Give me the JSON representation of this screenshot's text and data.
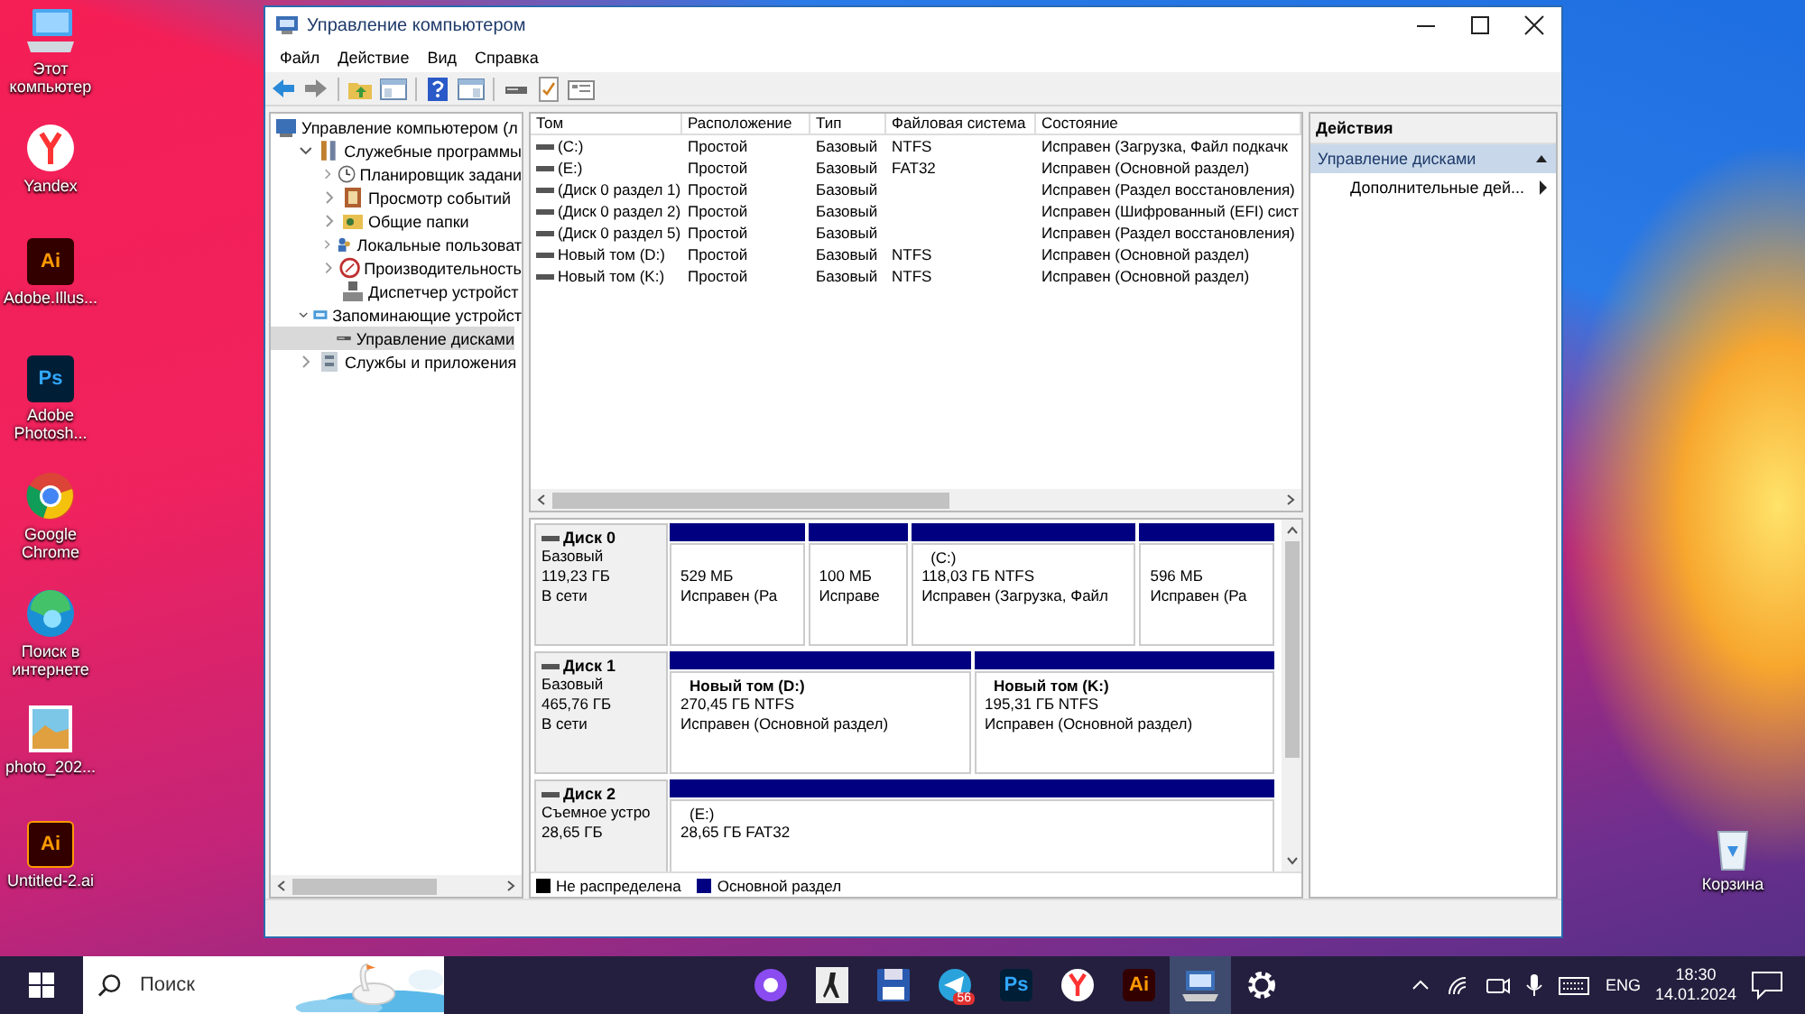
{
  "desktop_icons": [
    {
      "label": "Этот компьютер",
      "kind": "computer"
    },
    {
      "label": "Yandex",
      "kind": "yandex"
    },
    {
      "label": "Adobe.Illus...",
      "kind": "illustrator",
      "logo_text": "Ai"
    },
    {
      "label": "Adobe Photosh...",
      "kind": "photoshop",
      "logo_text": "Ps"
    },
    {
      "label": "Google Chrome",
      "kind": "chrome"
    },
    {
      "label": "Поиск в интернете",
      "kind": "edge"
    },
    {
      "label": "photo_202..."
    },
    {
      "label": "Untitled-2.ai",
      "kind": "illustrator-file",
      "logo_text": "Ai"
    }
  ],
  "recycle_bin": {
    "label": "Корзина"
  },
  "window": {
    "title": "Управление компьютером",
    "menu": [
      "Файл",
      "Действие",
      "Вид",
      "Справка"
    ],
    "tree": [
      {
        "label": "Управление компьютером (л",
        "selected": false,
        "children": [
          {
            "label": "Служебные программы",
            "expanded": true,
            "selected": false,
            "children": [
              {
                "label": "Планировщик задани",
                "expanded": false,
                "selected": false
              },
              {
                "label": "Просмотр событий",
                "expanded": false,
                "selected": false
              },
              {
                "label": "Общие папки",
                "expanded": false,
                "selected": false
              },
              {
                "label": "Локальные пользоват",
                "expanded": false,
                "selected": false
              },
              {
                "label": "Производительность",
                "expanded": false,
                "selected": false
              },
              {
                "label": "Диспетчер устройст",
                "selected": false
              }
            ]
          },
          {
            "label": "Запоминающие устройст",
            "expanded": true,
            "selected": false,
            "children": [
              {
                "label": "Управление дисками",
                "selected": true
              }
            ]
          },
          {
            "label": "Службы и приложения",
            "expanded": false,
            "selected": false
          }
        ]
      }
    ],
    "table": {
      "columns": [
        "Том",
        "Расположение",
        "Тип",
        "Файловая система",
        "Состояние"
      ],
      "rows": [
        [
          "(C:)",
          "Простой",
          "Базовый",
          "NTFS",
          "Исправен (Загрузка, Файл подкачк"
        ],
        [
          "(E:)",
          "Простой",
          "Базовый",
          "FAT32",
          "Исправен (Основной раздел)"
        ],
        [
          "(Диск 0 раздел 1)",
          "Простой",
          "Базовый",
          "",
          "Исправен (Раздел восстановления)"
        ],
        [
          "(Диск 0 раздел 2)",
          "Простой",
          "Базовый",
          "",
          "Исправен (Шифрованный (EFI) сист"
        ],
        [
          "(Диск 0 раздел 5)",
          "Простой",
          "Базовый",
          "",
          "Исправен (Раздел восстановления)"
        ],
        [
          "Новый том (D:)",
          "Простой",
          "Базовый",
          "NTFS",
          "Исправен (Основной раздел)"
        ],
        [
          "Новый том (K:)",
          "Простой",
          "Базовый",
          "NTFS",
          "Исправен (Основной раздел)"
        ]
      ]
    },
    "disks": [
      {
        "name": "Диск 0",
        "lines": [
          "Базовый",
          "119,23 ГБ",
          "В сети"
        ],
        "partitions": [
          {
            "size": "529 МБ",
            "status": "Исправен (Ра"
          },
          {
            "size": "100 МБ",
            "status": "Исправе"
          },
          {
            "name": "(C:)",
            "bold": false,
            "size": "118,03 ГБ NTFS",
            "status": "Исправен (Загрузка, Файл"
          },
          {
            "size": "596 МБ",
            "status": "Исправен (Ра"
          }
        ]
      },
      {
        "name": "Диск 1",
        "lines": [
          "Базовый",
          "465,76 ГБ",
          "В сети"
        ],
        "partitions": [
          {
            "name": "Новый том  (D:)",
            "bold": true,
            "size": "270,45 ГБ NTFS",
            "status": "Исправен (Основной раздел)"
          },
          {
            "name": "Новый том  (K:)",
            "bold": true,
            "size": "195,31 ГБ NTFS",
            "status": "Исправен (Основной раздел)"
          }
        ]
      },
      {
        "name": "Диск 2",
        "lines": [
          "Съемное устро",
          "28,65 ГБ"
        ],
        "partitions": [
          {
            "name": "(E:)",
            "bold": false,
            "size": "28,65 ГБ FAT32"
          }
        ]
      }
    ],
    "legend": [
      {
        "label": "Не распределена",
        "color": "#000000"
      },
      {
        "label": "Основной раздел",
        "color": "#000080"
      }
    ],
    "actions": {
      "title": "Действия",
      "section": "Управление дисками",
      "items": [
        "Дополнительные дей..."
      ]
    }
  },
  "taskbar": {
    "search_placeholder": "Поиск",
    "apps": [
      {
        "kind": "alice",
        "selected": false
      },
      {
        "kind": "game",
        "selected": false
      },
      {
        "kind": "floppy",
        "selected": false
      },
      {
        "kind": "telegram",
        "badge": "56",
        "selected": false
      },
      {
        "kind": "photoshop",
        "logo_text": "Ps",
        "selected": false
      },
      {
        "kind": "yandex",
        "selected": false
      },
      {
        "kind": "illustrator",
        "logo_text": "Ai",
        "selected": false
      },
      {
        "kind": "disk-manager",
        "selected": true
      },
      {
        "kind": "settings",
        "selected": false
      }
    ],
    "lang": "ENG",
    "time": "18:30",
    "date": "14.01.2024"
  }
}
